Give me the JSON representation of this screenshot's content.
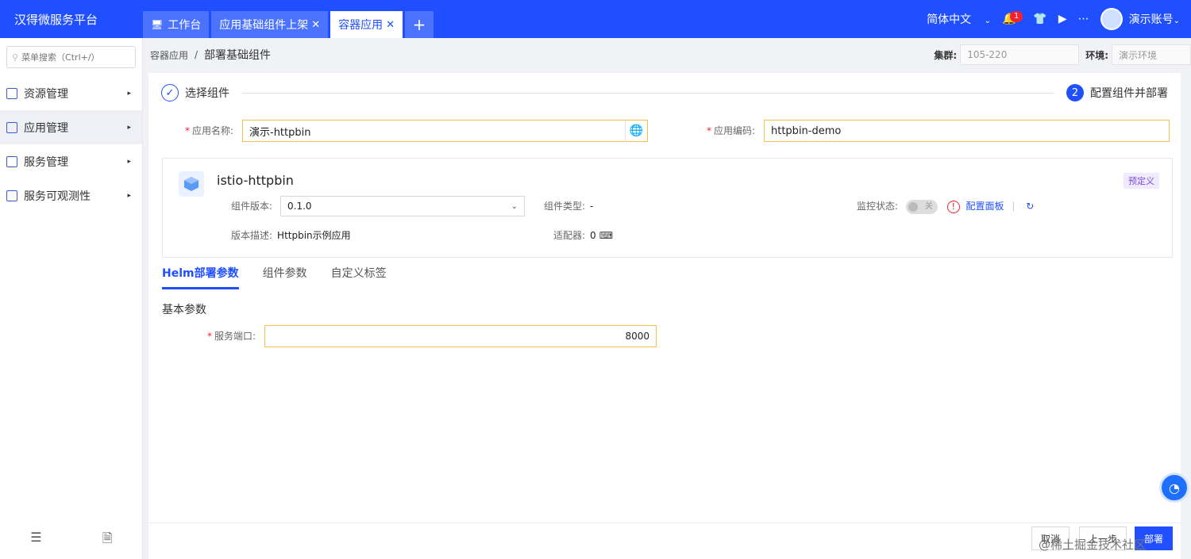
{
  "app": {
    "title": "汉得微服务平台"
  },
  "tabs": [
    {
      "label": "工作台",
      "closable": false
    },
    {
      "label": "应用基础组件上架",
      "closable": true
    },
    {
      "label": "容器应用",
      "closable": true,
      "active": true
    }
  ],
  "tab_add": "+",
  "header": {
    "language": "简体中文",
    "notifications": "1",
    "user": "演示账号"
  },
  "sidebar": {
    "search_placeholder": "菜单搜索（Ctrl+/）",
    "items": [
      {
        "label": "资源管理"
      },
      {
        "label": "应用管理",
        "active": true
      },
      {
        "label": "服务管理"
      },
      {
        "label": "服务可观测性"
      }
    ]
  },
  "breadcrumb": {
    "parent": "容器应用",
    "separator": "/",
    "current": "部署基础组件"
  },
  "context": {
    "cluster_label": "集群:",
    "cluster_value": "105-220",
    "env_label": "环境:",
    "env_value": "演示环境"
  },
  "steps": {
    "step1": "选择组件",
    "step2_num": "2",
    "step2": "配置组件并部署"
  },
  "form": {
    "app_name_label": "应用名称:",
    "app_name_value": "演示-httpbin",
    "app_code_label": "应用编码:",
    "app_code_value": "httpbin-demo"
  },
  "component": {
    "name": "istio-httpbin",
    "tag": "预定义",
    "version_label": "组件版本:",
    "version_value": "0.1.0",
    "type_label": "组件类型:",
    "type_value": "-",
    "desc_label": "版本描述:",
    "desc_value": "Httpbin示例应用",
    "adapter_label": "适配器:",
    "adapter_value": "0",
    "monitor_label": "监控状态:",
    "monitor_toggle": "关",
    "monitor_enabled": false,
    "config_link": "配置面板"
  },
  "subtabs": [
    {
      "label": "Helm部署参数",
      "active": true
    },
    {
      "label": "组件参数"
    },
    {
      "label": "自定义标签"
    }
  ],
  "section": {
    "title": "基本参数",
    "port_label": "服务端口:",
    "port_value": "8000"
  },
  "buttons": {
    "cancel": "取消",
    "prev": "上一步",
    "deploy": "部署"
  },
  "credit": "@稀土掘金技术社区",
  "colors": {
    "primary": "#1f4fff",
    "required": "#f5222d",
    "focus_border": "#f5c04a"
  }
}
